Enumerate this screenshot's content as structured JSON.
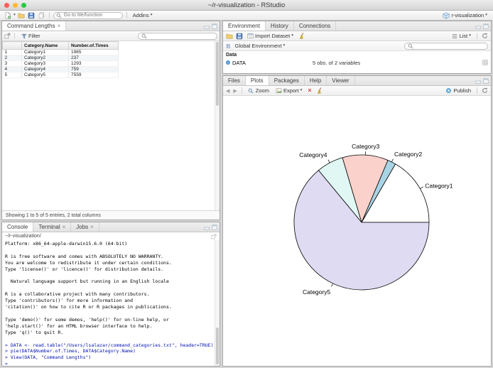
{
  "titlebar": {
    "title": "~/r-visualization - RStudio"
  },
  "toolbar": {
    "goto_placeholder": "Go to file/function",
    "addins_label": "Addins",
    "project_label": "r-visualization"
  },
  "data_viewer": {
    "tab_label": "Command Lengths",
    "toolbar": {
      "filter_label": "Filter"
    },
    "table": {
      "columns": [
        "Category.Name",
        "Number.of.Times"
      ],
      "rows": [
        {
          "n": "1",
          "name": "Category1",
          "times": "1965"
        },
        {
          "n": "2",
          "name": "Category2",
          "times": "237"
        },
        {
          "n": "3",
          "name": "Category3",
          "times": "1293"
        },
        {
          "n": "4",
          "name": "Category4",
          "times": "759"
        },
        {
          "n": "5",
          "name": "Category5",
          "times": "7559"
        }
      ]
    },
    "status": "Showing 1 to 5 of 5 entries, 2 total columns"
  },
  "console": {
    "tabs": [
      "Console",
      "Terminal",
      "Jobs"
    ],
    "path": "~/r-visualization/",
    "lines": [
      {
        "type": "output",
        "text": "Platform: x86_64-apple-darwin15.6.0 (64-bit)"
      },
      {
        "type": "output",
        "text": ""
      },
      {
        "type": "output",
        "text": "R is free software and comes with ABSOLUTELY NO WARRANTY."
      },
      {
        "type": "output",
        "text": "You are welcome to redistribute it under certain conditions."
      },
      {
        "type": "output",
        "text": "Type 'license()' or 'licence()' for distribution details."
      },
      {
        "type": "output",
        "text": ""
      },
      {
        "type": "output",
        "text": "  Natural language support but running in an English locale"
      },
      {
        "type": "output",
        "text": ""
      },
      {
        "type": "output",
        "text": "R is a collaborative project with many contributors."
      },
      {
        "type": "output",
        "text": "Type 'contributors()' for more information and"
      },
      {
        "type": "output",
        "text": "'citation()' on how to cite R or R packages in publications."
      },
      {
        "type": "output",
        "text": ""
      },
      {
        "type": "output",
        "text": "Type 'demo()' for some demos, 'help()' for on-line help, or"
      },
      {
        "type": "output",
        "text": "'help.start()' for an HTML browser interface to help."
      },
      {
        "type": "output",
        "text": "Type 'q()' to quit R."
      },
      {
        "type": "output",
        "text": ""
      },
      {
        "type": "input",
        "text": "> DATA <- read.table(\"/Users/lsalazar/command_categories.txt\", header=TRUE)"
      },
      {
        "type": "input",
        "text": "> pie(DATA$Number.of.Times, DATA$Category.Name)"
      },
      {
        "type": "input",
        "text": "> View(DATA, \"Command Lengths\")"
      },
      {
        "type": "input",
        "text": "> "
      }
    ]
  },
  "environment": {
    "tabs": [
      "Environment",
      "History",
      "Connections"
    ],
    "toolbar": {
      "import_label": "Import Dataset",
      "list_label": "List"
    },
    "scope_label": "Global Environment",
    "section_label": "Data",
    "objects": [
      {
        "name": "DATA",
        "summary": "5 obs. of 2 variables"
      }
    ]
  },
  "plots": {
    "tabs": [
      "Files",
      "Plots",
      "Packages",
      "Help",
      "Viewer"
    ],
    "toolbar": {
      "zoom_label": "Zoom",
      "export_label": "Export",
      "publish_label": "Publish"
    }
  },
  "chart_data": {
    "type": "pie",
    "title": "",
    "categories": [
      "Category1",
      "Category2",
      "Category3",
      "Category4",
      "Category5"
    ],
    "values": [
      1965,
      237,
      1293,
      759,
      7559
    ],
    "colors": [
      "#ffffff",
      "#a9d4e5",
      "#fad2cb",
      "#e0f7f4",
      "#dfdbf2"
    ],
    "start_angle_deg": 0,
    "direction": "counterclockwise",
    "legend_position": "none"
  }
}
